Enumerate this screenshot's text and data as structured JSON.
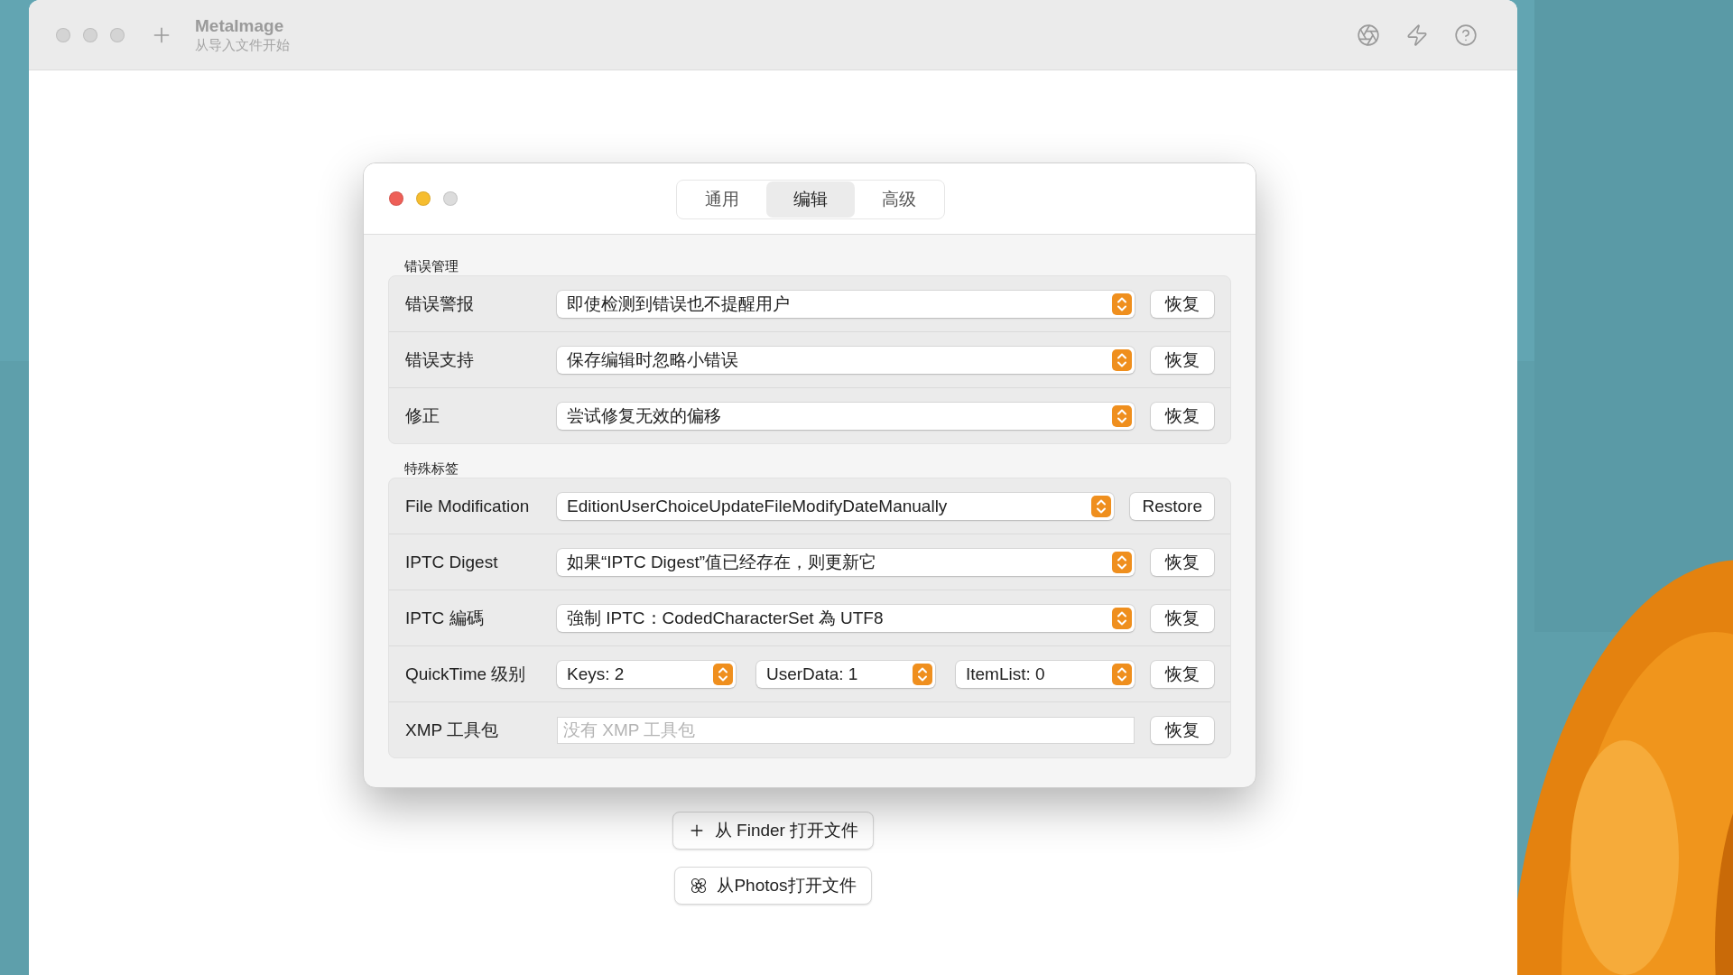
{
  "app": {
    "title": "MetaImage",
    "subtitle": "从导入文件开始"
  },
  "dialog": {
    "tabs": [
      {
        "label": "通用",
        "selected": false
      },
      {
        "label": "编辑",
        "selected": true
      },
      {
        "label": "高级",
        "selected": false
      }
    ],
    "sections": [
      {
        "title": "错误管理",
        "rows": [
          {
            "kind": "select",
            "label": "错误警报",
            "value": "即使检测到错误也不提醒用户",
            "button": "恢复"
          },
          {
            "kind": "select",
            "label": "错误支持",
            "value": "保存编辑时忽略小错误",
            "button": "恢复"
          },
          {
            "kind": "select",
            "label": "修正",
            "value": "尝试修复无效的偏移",
            "button": "恢复"
          }
        ]
      },
      {
        "title": "特殊标签",
        "rows": [
          {
            "kind": "select",
            "label": "File Modification",
            "value": "EditionUserChoiceUpdateFileModifyDateManually",
            "button": "Restore"
          },
          {
            "kind": "select",
            "label": "IPTC Digest",
            "value": "如果“IPTC Digest”值已经存在，则更新它",
            "button": "恢复"
          },
          {
            "kind": "select",
            "label": "IPTC 編碼",
            "value": "強制 IPTC：CodedCharacterSet 為 UTF8",
            "button": "恢复"
          },
          {
            "kind": "multi",
            "label": "QuickTime 级别",
            "values": [
              "Keys: 2",
              "UserData: 1",
              "ItemList: 0"
            ],
            "button": "恢复"
          },
          {
            "kind": "field",
            "label": "XMP 工具包",
            "placeholder": "没有 XMP 工具包",
            "button": "恢复"
          }
        ]
      }
    ]
  },
  "actions": [
    {
      "kind": "finder",
      "label": "从 Finder 打开文件"
    },
    {
      "kind": "photos",
      "label": "从Photos打开文件"
    }
  ]
}
